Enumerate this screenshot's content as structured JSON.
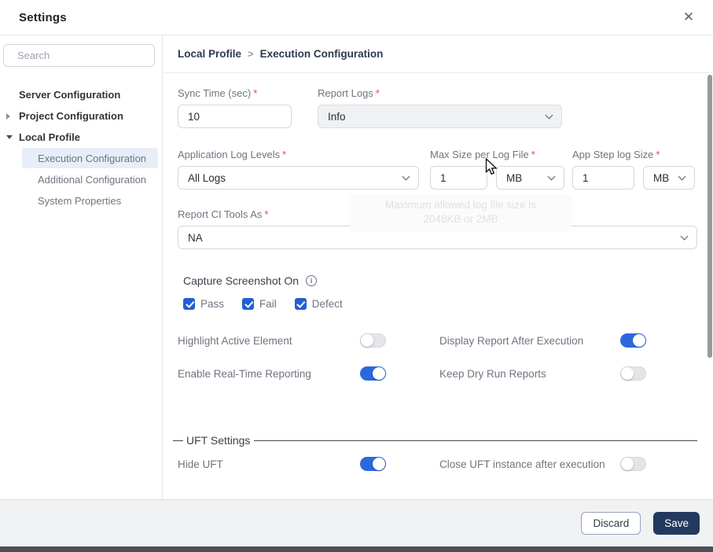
{
  "dialog": {
    "title": "Settings",
    "close_glyph": "✕"
  },
  "sidebar": {
    "search_placeholder": "Search",
    "items": [
      {
        "label": "Server Configuration"
      },
      {
        "label": "Project Configuration"
      },
      {
        "label": "Local Profile"
      }
    ],
    "sub_items": [
      {
        "label": "Execution Configuration",
        "selected": true
      },
      {
        "label": "Additional Configuration",
        "selected": false
      },
      {
        "label": "System Properties",
        "selected": false
      }
    ]
  },
  "breadcrumb": {
    "parent": "Local Profile",
    "separator": ">",
    "current": "Execution Configuration"
  },
  "form": {
    "sync_time": {
      "label": "Sync Time (sec)",
      "required": "*",
      "value": "10"
    },
    "report_logs": {
      "label": "Report Logs",
      "required": "*",
      "value": "Info"
    },
    "app_log_levels": {
      "label": "Application Log Levels",
      "required": "*",
      "value": "All Logs"
    },
    "max_size": {
      "label": "Max Size per Log File",
      "required": "*",
      "value": "1",
      "unit": "MB"
    },
    "app_step_size": {
      "label": "App Step log Size",
      "required": "*",
      "value": "1",
      "unit": "MB"
    },
    "report_ci": {
      "label": "Report CI Tools As",
      "required": "*",
      "value": "NA"
    },
    "tooltip": "Maximum allowed log file size is 2048KB or 2MB",
    "capture": {
      "label": "Capture Screenshot On",
      "options": [
        {
          "label": "Pass",
          "checked": true
        },
        {
          "label": "Fail",
          "checked": true
        },
        {
          "label": "Defect",
          "checked": true
        }
      ]
    },
    "toggles": [
      {
        "label": "Highlight Active Element",
        "on": false
      },
      {
        "label": "Display Report After Execution",
        "on": true
      },
      {
        "label": "Enable Real-Time Reporting",
        "on": true
      },
      {
        "label": "Keep Dry Run Reports",
        "on": false
      }
    ],
    "uft": {
      "section": "UFT Settings",
      "toggles": [
        {
          "label": "Hide UFT",
          "on": true
        },
        {
          "label": "Close UFT instance after execution",
          "on": false
        }
      ]
    }
  },
  "footer": {
    "discard": "Discard",
    "save": "Save"
  },
  "colors": {
    "accent_blue": "#2c68dd",
    "checkbox_blue": "#2160d3",
    "save_navy": "#233a5e",
    "required_red": "#e5484d",
    "selected_item_bg": "#e8eef8"
  }
}
